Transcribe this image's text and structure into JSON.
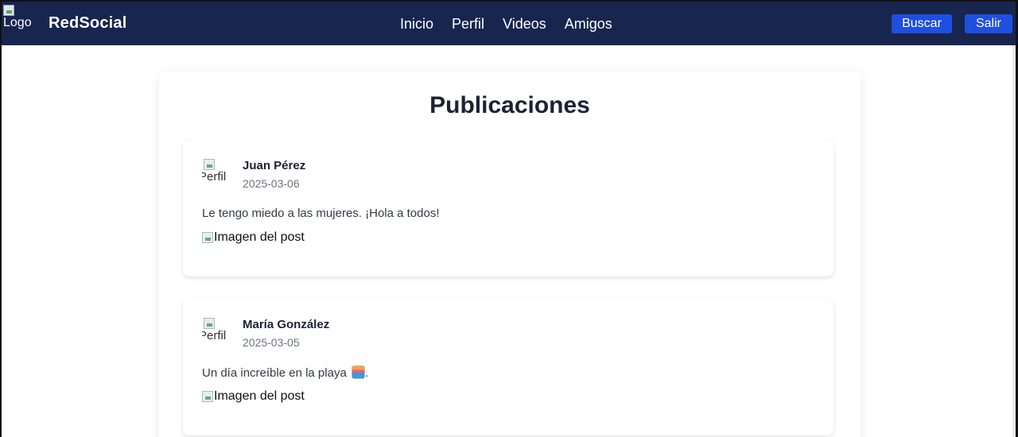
{
  "navbar": {
    "logo_alt": "Logo",
    "brand": "RedSocial",
    "links": [
      "Inicio",
      "Perfil",
      "Videos",
      "Amigos"
    ],
    "search_button": "Buscar",
    "logout_button": "Salir"
  },
  "main": {
    "title": "Publicaciones",
    "posts": [
      {
        "avatar_alt": "Perfil",
        "author": "Juan Pérez",
        "date": "2025-03-06",
        "text": "Le tengo miedo a las mujeres. ¡Hola a todos!",
        "image_alt": "Imagen del post"
      },
      {
        "avatar_alt": "Perfil",
        "author": "María González",
        "date": "2025-03-05",
        "text": "Un día increíble en la playa",
        "text_suffix": ".",
        "image_alt": "Imagen del post"
      }
    ]
  },
  "colors": {
    "navbar_bg": "#18254f",
    "button_bg": "#1f4fe0",
    "title_text": "#1a2233",
    "date_text": "#6b7280"
  }
}
